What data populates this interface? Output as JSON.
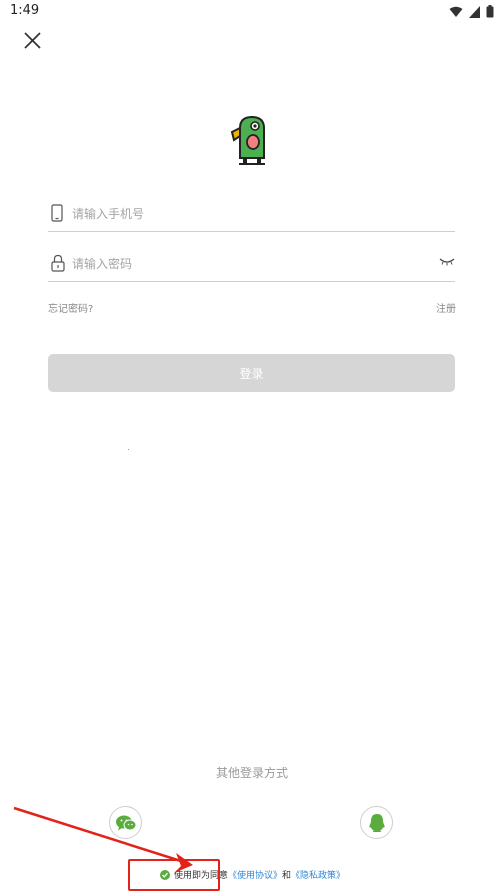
{
  "status_bar": {
    "time": "1:49"
  },
  "icons": {
    "close": "close-icon",
    "phone": "phone-icon",
    "lock": "lock-icon",
    "eye": "eye-closed-icon",
    "wechat": "wechat-icon",
    "qq": "qq-icon",
    "check": "check-icon"
  },
  "form": {
    "phone_placeholder": "请输入手机号",
    "password_placeholder": "请输入密码",
    "forgot_label": "忘记密码?",
    "register_label": "注册",
    "login_label": "登录"
  },
  "other_login": {
    "label": "其他登录方式"
  },
  "agreement": {
    "prefix": "使用即为同意",
    "terms": "《使用协议》",
    "and": "和",
    "privacy": "《隐私政策》"
  },
  "colors": {
    "accent_green": "#5aac3c",
    "link_blue": "#2f86d6",
    "annotation_red": "#e2231a",
    "button_disabled": "#d6d6d6"
  }
}
